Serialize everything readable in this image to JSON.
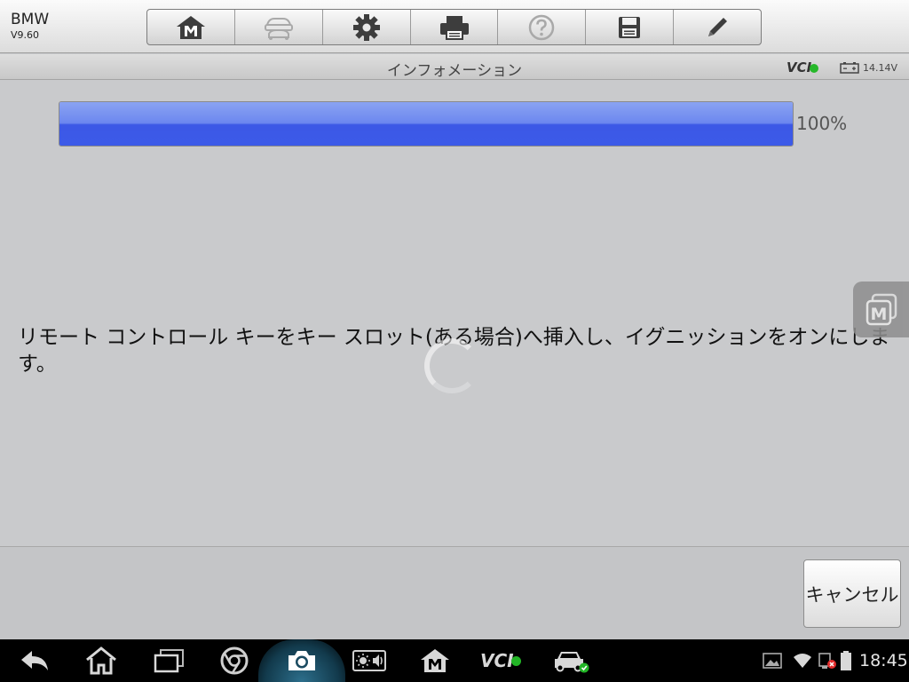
{
  "header": {
    "brand": "BMW",
    "version": "V9.60",
    "toolbar": [
      {
        "name": "home",
        "icon": "home-m-icon"
      },
      {
        "name": "vehicle-swap",
        "icon": "car-swap-icon"
      },
      {
        "name": "settings",
        "icon": "gear-icon"
      },
      {
        "name": "print",
        "icon": "printer-icon"
      },
      {
        "name": "help",
        "icon": "help-icon"
      },
      {
        "name": "save",
        "icon": "floppy-disk-icon"
      },
      {
        "name": "edit",
        "icon": "pencil-icon"
      }
    ]
  },
  "titlebar": {
    "title": "インフォメーション",
    "vci": "VCI",
    "voltage": "14.14V"
  },
  "progress": {
    "value": 100,
    "text": "100%"
  },
  "message": "リモート コントロール キーをキー スロット(ある場合)へ挿入し、イグニッションをオンにします。",
  "actions": {
    "cancel_label": "キャンセル"
  },
  "float_button": {
    "label": "M"
  },
  "navbar": {
    "vci": "VCI",
    "clock": "18:45"
  },
  "colors": {
    "progress_fill": "#3c58e6",
    "vci_ok": "#26b82a",
    "navbar_bg": "#000000"
  }
}
